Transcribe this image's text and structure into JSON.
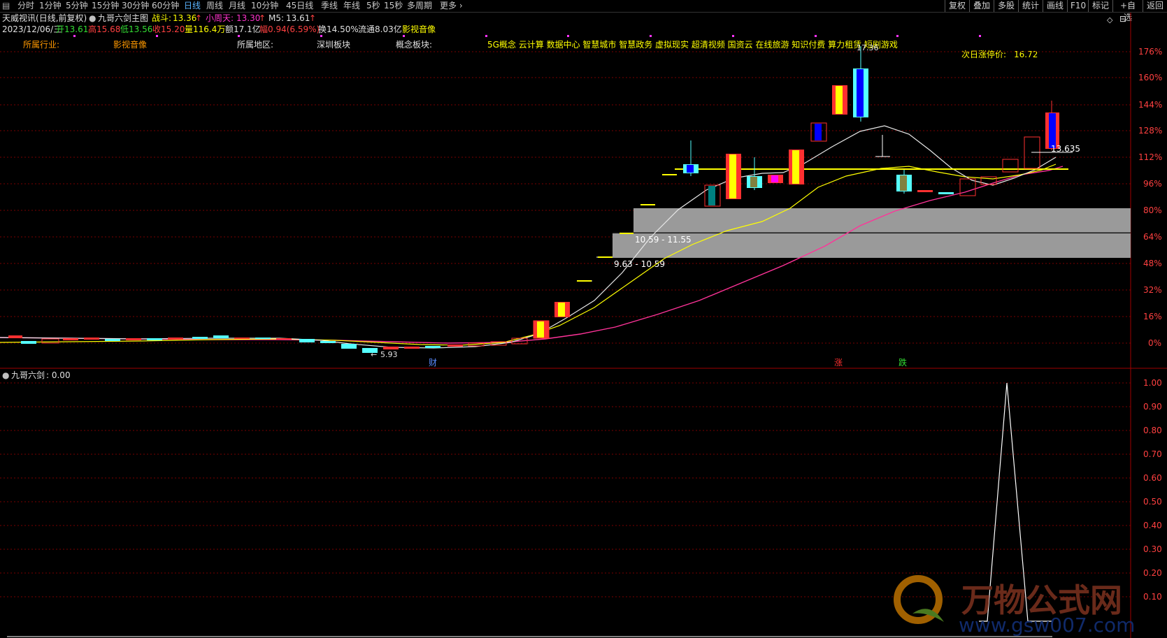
{
  "toolbar": {
    "periods": [
      "分时",
      "1分钟",
      "5分钟",
      "15分钟",
      "30分钟",
      "60分钟",
      "日线",
      "周线",
      "月线",
      "10分钟",
      "45日线",
      "季线",
      "年线",
      "5秒",
      "15秒",
      "多周期",
      "更多"
    ],
    "active_period": "日线",
    "right_buttons": [
      "复权",
      "叠加",
      "多股",
      "统计",
      "画线",
      "F10",
      "标记",
      "+自选",
      "返回"
    ]
  },
  "header": {
    "stock_name": "天威视讯",
    "mode": "(日线,前复权)",
    "indicator_name": "九哥六剑主图",
    "zhandou_label": "战斗:",
    "zhandou_value": "13.36",
    "xiaozhoutian_label": "小周天:",
    "xiaozhoutian_value": "13.30",
    "m5_label": "M5:",
    "m5_value": "13.61"
  },
  "quote": {
    "date": "2023/12/06/三",
    "open": "开13.61",
    "high": "高15.68",
    "low": "低13.56",
    "close": "收15.20",
    "volume": "量116.4万",
    "amount": "额17.1亿",
    "change": "幅0.94(6.59%)",
    "turnover": "换14.50%",
    "float": "流通8.03亿",
    "sector": "影视音像"
  },
  "info_row": {
    "industry_label": "所属行业:",
    "industry_value": "影视音像",
    "region_label": "所属地区:",
    "region_value": "深圳板块",
    "concept_label": "概念板块:",
    "concept_value": "5G概念 云计算 数据中心 智慧城市 智慧政务 虚拟现实 超清视频 国资云 在线旅游 知识付费 算力租赁 短剧游戏",
    "limit_label": "次日涨停价:",
    "limit_value": "16.72"
  },
  "main_chart": {
    "y_ticks": [
      "176%",
      "160%",
      "144%",
      "128%",
      "112%",
      "96%",
      "80%",
      "64%",
      "48%",
      "32%",
      "16%",
      "0%"
    ],
    "box_labels": [
      "10.59 - 11.55",
      "9.63 - 10.59"
    ],
    "price_marker": "13.635",
    "high_marker": "17.36",
    "low_marker": "5.93",
    "event_labels": [
      "财",
      "涨",
      "跌"
    ]
  },
  "sub_chart": {
    "title": "九哥六剑",
    "value_text": ": 0.00",
    "y_ticks": [
      "1.00",
      "0.90",
      "0.80",
      "0.70",
      "0.60",
      "0.50",
      "0.40",
      "0.30",
      "0.20",
      "0.10"
    ],
    "signal_values": [
      0,
      1,
      0
    ]
  },
  "watermark": {
    "cn": "万物公式网",
    "url": "www.gsw007.com"
  },
  "colors": {
    "up": "#ff3030",
    "down": "#55ffff",
    "ma_white": "#e8e8e8",
    "ma_yellow": "#ffff00",
    "ma_pink": "#ff3399",
    "grid": "#7a0000"
  }
}
